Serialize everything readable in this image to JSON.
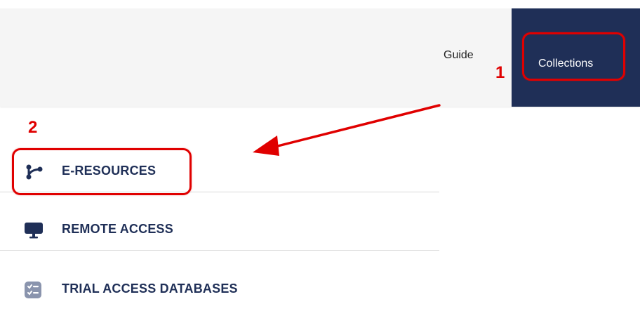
{
  "nav": {
    "guide_label": "Guide",
    "collections_label": "Collections"
  },
  "annotations": {
    "step1": "1",
    "step2": "2"
  },
  "menu": {
    "items": [
      {
        "label": "E-RESOURCES",
        "icon": "branch-icon"
      },
      {
        "label": "REMOTE ACCESS",
        "icon": "monitor-icon"
      },
      {
        "label": "TRIAL ACCESS DATABASES",
        "icon": "checklist-icon"
      }
    ]
  },
  "colors": {
    "navy": "#1f2f57",
    "callout_red": "#e00000"
  }
}
